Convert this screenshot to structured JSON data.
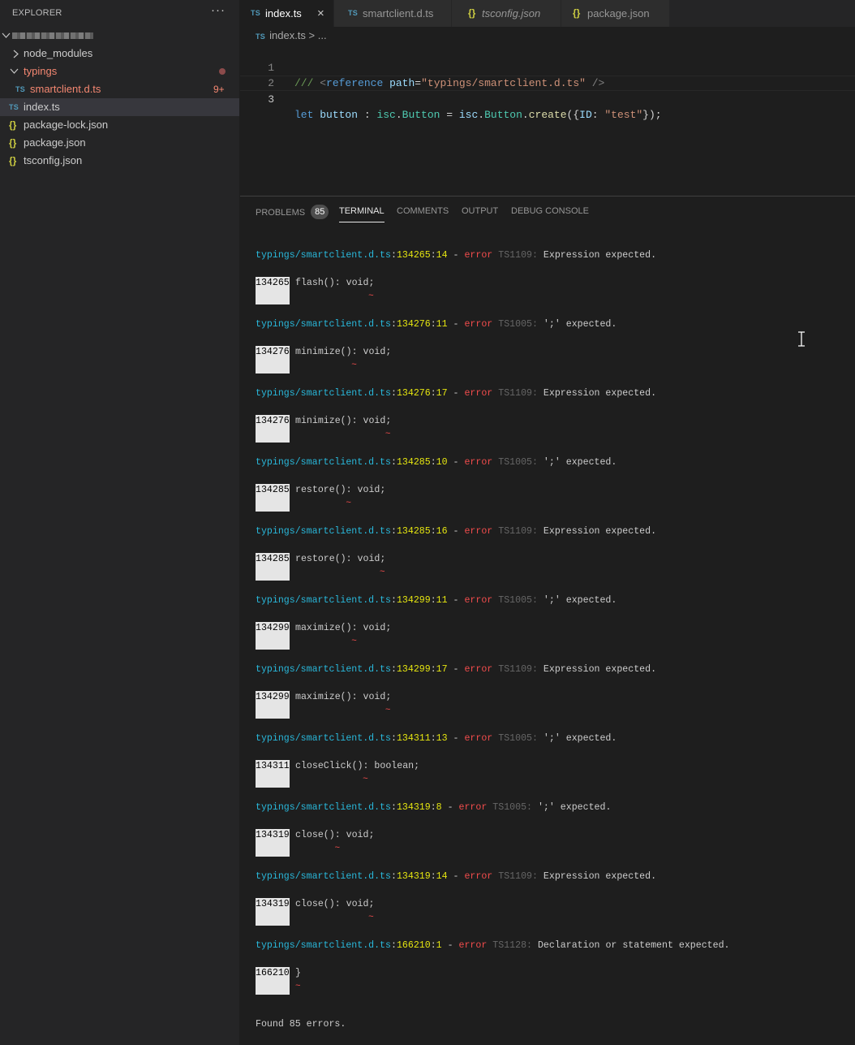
{
  "sidebar": {
    "title": "EXPLORER",
    "more_icon": "ellipsis-icon",
    "root_folder": {
      "label": "[blurred]",
      "expanded": true
    },
    "items": [
      {
        "label": "node_modules",
        "type": "folder",
        "expanded": false,
        "status": "normal"
      },
      {
        "label": "typings",
        "type": "folder",
        "expanded": true,
        "status": "error",
        "decoration": "dot"
      },
      {
        "label": "smartclient.d.ts",
        "type": "ts-file",
        "status": "error",
        "badge": "9+",
        "icon_text": "TS"
      },
      {
        "label": "index.ts",
        "type": "ts-file",
        "status": "selected",
        "icon_text": "TS"
      },
      {
        "label": "package-lock.json",
        "type": "json-file",
        "icon_text": "{}"
      },
      {
        "label": "package.json",
        "type": "json-file",
        "icon_text": "{}"
      },
      {
        "label": "tsconfig.json",
        "type": "json-file",
        "icon_text": "{}"
      }
    ]
  },
  "tabs": [
    {
      "label": "index.ts",
      "icon_text": "TS",
      "active": true,
      "close": "×"
    },
    {
      "label": "smartclient.d.ts",
      "icon_text": "TS",
      "active": false
    },
    {
      "label": "tsconfig.json",
      "icon_text": "{}",
      "active": false,
      "italic": true
    },
    {
      "label": "package.json",
      "icon_text": "{}",
      "active": false
    }
  ],
  "editor": {
    "breadcrumb": {
      "icon_text": "TS",
      "file": "index.ts",
      "separator": ">",
      "rest": "..."
    },
    "lines": [
      {
        "num": "1",
        "text": "/// <reference path=\"typings/smartclient.d.ts\" />"
      },
      {
        "num": "2",
        "text": ""
      },
      {
        "num": "3",
        "text": "let button : isc.Button = isc.Button.create({ID: \"test\"});"
      }
    ],
    "tokens": {
      "l1_comment": "/// ",
      "l1_lt": "<",
      "l1_tag": "reference",
      "l1_attr": "path",
      "l1_eq": "=",
      "l1_str": "\"typings/smartclient.d.ts\"",
      "l1_close": " />",
      "l3_let": "let",
      "l3_var": "button",
      "l3_colon": " : ",
      "l3_ns1": "isc",
      "l3_dot1": ".",
      "l3_type": "Button",
      "l3_eq": " = ",
      "l3_ns2": "isc",
      "l3_dot2": ".",
      "l3_cls": "Button",
      "l3_dot3": ".",
      "l3_fn": "create",
      "l3_open": "({",
      "l3_key": "ID",
      "l3_colon2": ": ",
      "l3_str": "\"test\"",
      "l3_end": "});"
    }
  },
  "panel": {
    "tabs": [
      {
        "label": "PROBLEMS",
        "count": "85",
        "active": false
      },
      {
        "label": "TERMINAL",
        "active": true
      },
      {
        "label": "COMMENTS",
        "active": false
      },
      {
        "label": "OUTPUT",
        "active": false
      },
      {
        "label": "DEBUG CONSOLE",
        "active": false
      }
    ],
    "terminal": {
      "errors": [
        {
          "path": "typings/smartclient.d.ts",
          "line": "134265",
          "col": "14",
          "level": "error",
          "code": "TS1109:",
          "message": "Expression expected.",
          "src": "flash(): void;"
        },
        {
          "path": "typings/smartclient.d.ts",
          "line": "134276",
          "col": "11",
          "level": "error",
          "code": "TS1005:",
          "message": "';' expected.",
          "src": "minimize(): void;"
        },
        {
          "path": "typings/smartclient.d.ts",
          "line": "134276",
          "col": "17",
          "level": "error",
          "code": "TS1109:",
          "message": "Expression expected.",
          "src": "minimize(): void;"
        },
        {
          "path": "typings/smartclient.d.ts",
          "line": "134285",
          "col": "10",
          "level": "error",
          "code": "TS1005:",
          "message": "';' expected.",
          "src": "restore(): void;"
        },
        {
          "path": "typings/smartclient.d.ts",
          "line": "134285",
          "col": "16",
          "level": "error",
          "code": "TS1109:",
          "message": "Expression expected.",
          "src": "restore(): void;"
        },
        {
          "path": "typings/smartclient.d.ts",
          "line": "134299",
          "col": "11",
          "level": "error",
          "code": "TS1005:",
          "message": "';' expected.",
          "src": "maximize(): void;"
        },
        {
          "path": "typings/smartclient.d.ts",
          "line": "134299",
          "col": "17",
          "level": "error",
          "code": "TS1109:",
          "message": "Expression expected.",
          "src": "maximize(): void;"
        },
        {
          "path": "typings/smartclient.d.ts",
          "line": "134311",
          "col": "13",
          "level": "error",
          "code": "TS1005:",
          "message": "';' expected.",
          "src": "closeClick(): boolean;"
        },
        {
          "path": "typings/smartclient.d.ts",
          "line": "134319",
          "col": "8",
          "level": "error",
          "code": "TS1005:",
          "message": "';' expected.",
          "src": "close(): void;"
        },
        {
          "path": "typings/smartclient.d.ts",
          "line": "134319",
          "col": "14",
          "level": "error",
          "code": "TS1109:",
          "message": "Expression expected.",
          "src": "close(): void;"
        },
        {
          "path": "typings/smartclient.d.ts",
          "line": "166210",
          "col": "1",
          "level": "error",
          "code": "TS1128:",
          "message": "Declaration or statement expected.",
          "src": "}"
        }
      ],
      "squiggle": "~",
      "summary": "Found 85 errors."
    }
  },
  "colors": {
    "path": "#29b8db",
    "location": "#e5e510",
    "error": "#f14c4c",
    "error_code": "#666666",
    "sidebar_error": "#f48771",
    "ts_icon": "#519aba",
    "json_icon": "#cbcb41"
  }
}
